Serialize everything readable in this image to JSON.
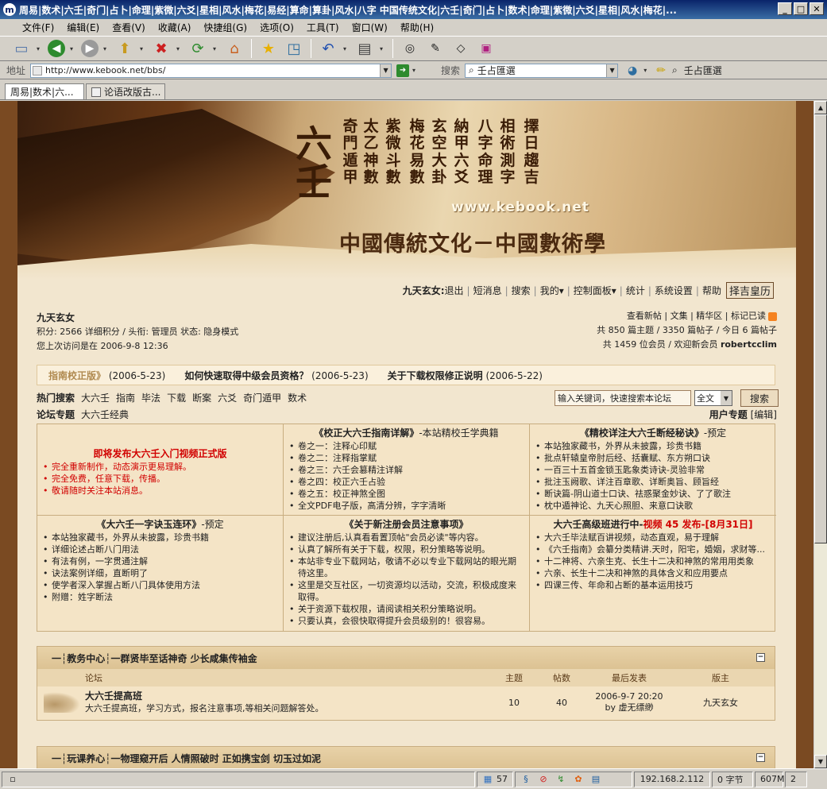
{
  "window": {
    "title": "周易|数术|六壬|奇门|占卜|命理|紫微|六爻|星相|风水|梅花|易经|算命|算卦|风水|八字 中国传统文化|六壬|奇门|占卜|数术|命理|紫微|六爻|星相|风水|梅花|..."
  },
  "menu": [
    "文件(F)",
    "编辑(E)",
    "查看(V)",
    "收藏(A)",
    "快捷组(G)",
    "选项(O)",
    "工具(T)",
    "窗口(W)",
    "帮助(H)"
  ],
  "address": {
    "label": "地址",
    "url": "http://www.kebook.net/bbs/",
    "search_label": "搜索",
    "search_value": "壬占匯選",
    "search_shortcut": "壬占匯選"
  },
  "tabs": [
    {
      "label": "周易|数术|六...",
      "active": true
    },
    {
      "label": "论语改版古...",
      "active": false
    }
  ],
  "banner": {
    "big_chars": "六壬",
    "columns": [
      "擇日趨吉",
      "相術測字",
      "八字命理",
      "納甲六爻",
      "玄空大卦",
      "梅花易數",
      "紫微斗數",
      "太乙神數",
      "奇門遁甲"
    ],
    "site": "www.kebook.net",
    "slogan": "中國傳統文化－中國數術學"
  },
  "nav": {
    "user": "九天玄女:",
    "links": [
      "退出",
      "短消息",
      "搜索",
      "我的▾",
      "控制面板▾",
      "统计",
      "系统设置",
      "帮助"
    ],
    "tool": "择吉皇历"
  },
  "userinfo": {
    "name": "九天玄女",
    "line1": "积分: 2566 详细积分 / 头衔: 管理员 状态: 隐身模式",
    "line2": "您上次访问是在 2006-9-8 12:36"
  },
  "stats": {
    "line1": "查看新帖 | 文集 | 精华区 | 标记已读",
    "line2": "共 850 篇主题 / 3350 篇帖子 / 今日 6 篇帖子",
    "line3_prefix": "共 1459 位会员 / 欢迎新会员 ",
    "line3_member": "robertcclim"
  },
  "announcements": [
    {
      "title": "指南校正版》",
      "date": "(2006-5-23)",
      "faded": true
    },
    {
      "title": "如何快速取得中级会员资格？",
      "date": "(2006-5-23)",
      "faded": false
    },
    {
      "title": "关于下载权限修正说明",
      "date": "(2006-5-22)",
      "faded": false
    }
  ],
  "hot": {
    "label": "热门搜索",
    "items": [
      "大六壬",
      "指南",
      "毕法",
      "下载",
      "断案",
      "六爻",
      "奇门遁甲",
      "数术"
    ]
  },
  "search": {
    "placeholder": "输入关键词，快速搜索本论坛",
    "scope": "全文",
    "button": "搜索"
  },
  "topics": {
    "label": "论坛专题",
    "items": [
      "大六壬经典"
    ],
    "user_label": "用户专题",
    "edit": "[编辑]"
  },
  "grid": [
    {
      "title": "即将发布大六壬入门视频正式版",
      "subtitle": "",
      "red": true,
      "items": [
        "完全重新制作，动态演示更易理解。",
        "完全免费，任意下载，传播。",
        "敬请随时关注本站消息。"
      ]
    },
    {
      "title": "《校正大六壬指南详解》",
      "subtitle": "-本站精校壬学典籍",
      "red": false,
      "items": [
        "卷之一：注释心印赋",
        "卷之二：注释指掌赋",
        "卷之三：六壬会篡精注详解",
        "卷之四：校正六壬占验",
        "卷之五：校正神煞全图",
        "全文PDF电子版，高清分辨，字字清晰"
      ]
    },
    {
      "title": "《精校详注大六壬断经秘诀》",
      "subtitle": "-预定",
      "red": false,
      "items": [
        "本站独家藏书，外界从未披露，珍贵书籍",
        "批点轩辕皇帝肘后经、括囊赋、东方朔口诀",
        "一百三十五首金锁玉匙象类诗诀-灵验非常",
        "批注玉阙歌、详注百章歌、详断奥旨、顾旨经",
        "断诀篇-阴山道士口诀、祛惑聚金妙诀、了了歌注",
        "枕中遁神论、九天心照胆、来意口诀歌"
      ]
    },
    {
      "title": "《大六壬一字诀玉连环》",
      "subtitle": "-预定",
      "red": false,
      "items": [
        "本站独家藏书，外界从未披露，珍贵书籍",
        "详细论述占断八门用法",
        "有法有例，一字贯通注解",
        "诀法案例详细，直断明了",
        "使学者深入掌握占断八门具体使用方法",
        "附赠：姓字断法"
      ]
    },
    {
      "title": "《关于新注册会员注意事项》",
      "subtitle": "",
      "red": false,
      "items": [
        "建议注册后,认真看看置顶帖\"会员必读\"等内容。",
        "认真了解所有关于下载，权限，积分策略等说明。",
        "本站非专业下载网站，敬请不必以专业下载网站的眼光期待这里。",
        "这里是交互社区，一切资源均以活动，交流，积极成度来取得。",
        "关于资源下载权限，请阅读相关积分策略说明。",
        "只要认真，会很快取得提升会员级别的！很容易。"
      ]
    },
    {
      "title": "大六壬高级班进行中-",
      "title_red": "视频 45 发布-[8月31日]",
      "subtitle": "",
      "red": false,
      "items": [
        "大六壬毕法赋百讲视频，动态直观，易于理解",
        "《六壬指南》会纂分类精讲.天时，阳宅，婚姻，求财等...",
        "十二神将、六亲生克、长生十二决和神煞的常用用类象",
        "六亲、长生十二决和神煞的具体含义和应用要点",
        "四课三传、年命和占断的基本运用技巧"
      ]
    }
  ],
  "sections": [
    {
      "title": "一┆教务中心┆一群贤毕至话神奇  少长咸集传袖金",
      "columns": {
        "forum": "论坛",
        "topics": "主题",
        "posts": "帖数",
        "last": "最后发表",
        "mod": "版主"
      },
      "rows": [
        {
          "name": "大六壬提高班",
          "desc": "大六壬提高班，学习方式，报名注意事项,等相关问题解答处。",
          "topics": "10",
          "posts": "40",
          "last_date": "2006-9-7 20:20",
          "last_by": "by 虚无缥缈",
          "mod": "九天玄女"
        }
      ]
    },
    {
      "title": "一┆玩课养心┆一物理窥开后  人情照破时  正如携宝剑  切玉过如泥",
      "columns": {},
      "rows": []
    }
  ],
  "status": {
    "count": "57",
    "ip": "192.168.2.112",
    "bytes": "0 字节",
    "mem": "607M",
    "num": "2"
  }
}
